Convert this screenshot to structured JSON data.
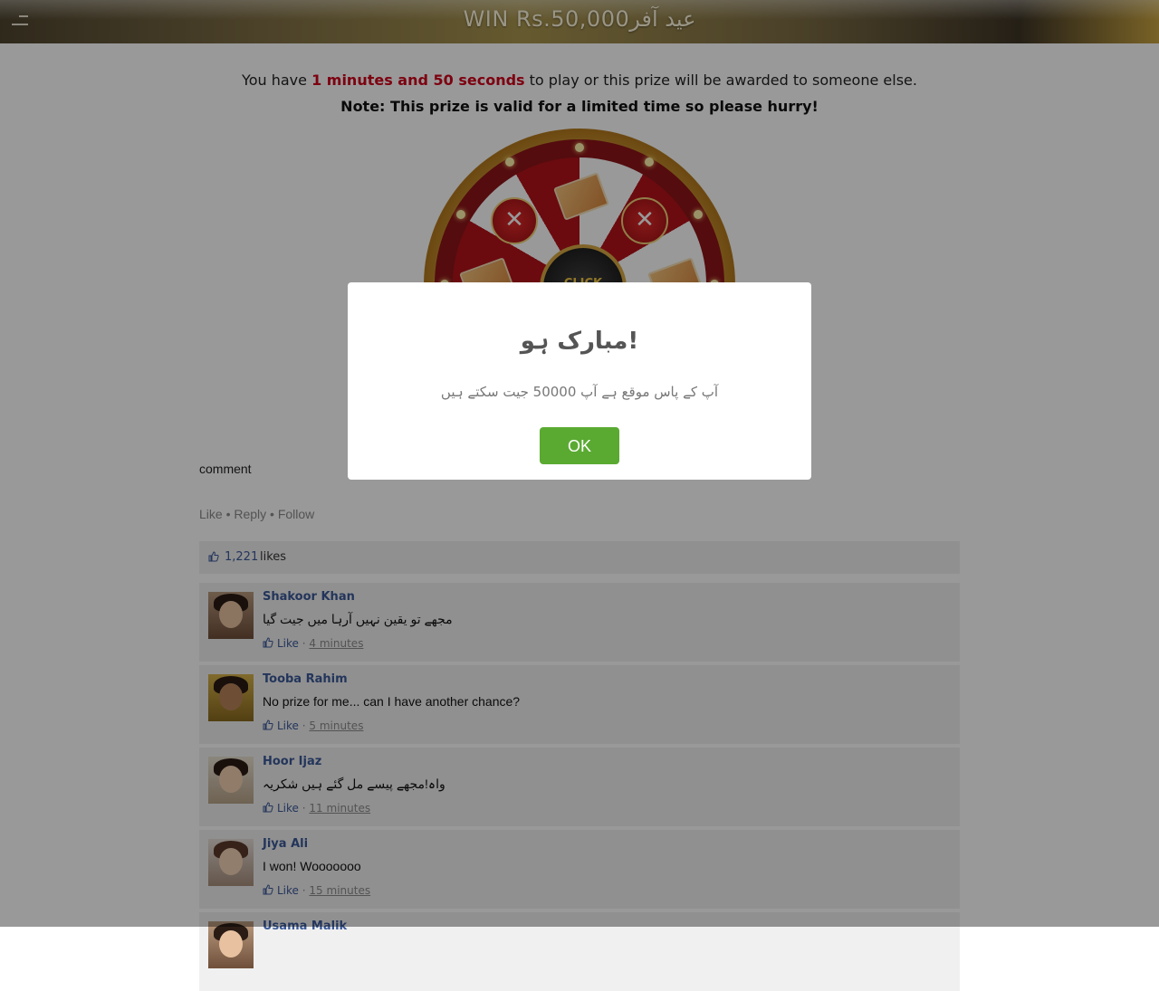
{
  "header": {
    "title": "WIN Rs.50,000عید آفر"
  },
  "countdown": {
    "prefix": "You have",
    "time": "1 minutes and 50 seconds",
    "suffix": "to play or this prize will be awarded to someone else."
  },
  "note": "Note: This prize is valid for a limited time so please hurry!",
  "wheel": {
    "center_label": "CLICK"
  },
  "comment_box": {
    "label": "comment",
    "actions": "Like • Reply • Follow"
  },
  "likes": {
    "count": "1,221",
    "word": "likes"
  },
  "comments": [
    {
      "name": "Shakoor Khan",
      "text": "مجھے تو یقین نہیں آرہا میں جیت گیا",
      "like": "Like",
      "time": "4 minutes"
    },
    {
      "name": "Tooba Rahim",
      "text": "No prize for me... can I have another chance?",
      "like": "Like",
      "time": "5 minutes"
    },
    {
      "name": "Hoor Ijaz",
      "text": "واہ!مجھے پیسے مل گئے ہیں شکریہ",
      "like": "Like",
      "time": "11 minutes"
    },
    {
      "name": "Jiya Ali",
      "text": "I won! Wooooooo",
      "like": "Like",
      "time": "15 minutes"
    },
    {
      "name": "Usama Malik",
      "text": "",
      "like": "",
      "time": ""
    }
  ],
  "modal": {
    "title": "مبارک ہو!",
    "message": "آپ کے پاس موقع ہے آپ 50000 جیت سکتے ہیں",
    "ok_label": "OK"
  },
  "colors": {
    "accent_red": "#d0021b",
    "link_blue": "#3b5998",
    "ok_green": "#5aaa32"
  }
}
